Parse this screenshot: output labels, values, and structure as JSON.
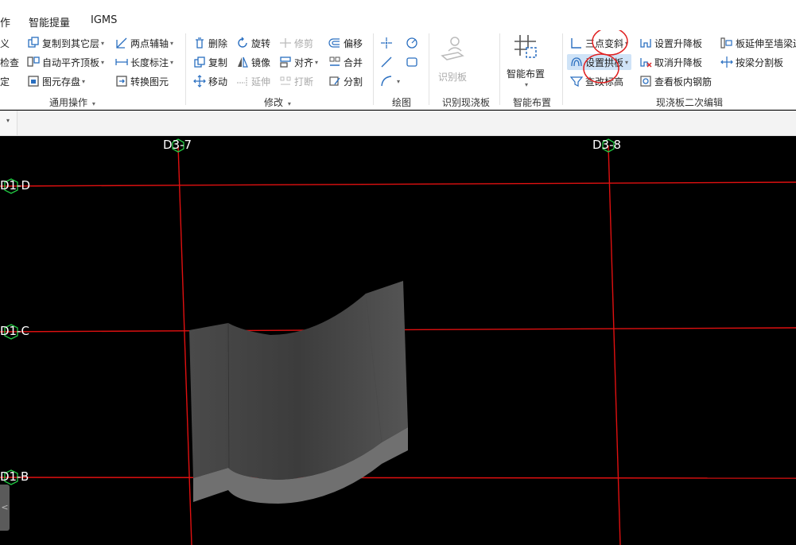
{
  "menubar": {
    "items": [
      {
        "label": "作"
      },
      {
        "label": "智能提量"
      },
      {
        "label": "IGMS"
      }
    ]
  },
  "ribbon": {
    "col0": [
      "义",
      "检查",
      "定"
    ],
    "general": {
      "copy_to_layer": "复制到其它层",
      "auto_align_top": "自动平齐顶板",
      "element_save": "图元存盘",
      "two_point_axis": "两点辅轴",
      "length_mark": "长度标注",
      "convert_element": "转换图元",
      "group_label": "通用操作"
    },
    "modify": {
      "delete": "删除",
      "copy": "复制",
      "move": "移动",
      "rotate": "旋转",
      "mirror": "镜像",
      "extend": "延伸",
      "trim": "修剪",
      "align": "对齐",
      "break": "打断",
      "offset": "偏移",
      "merge": "合并",
      "split": "分割",
      "group_label": "修改"
    },
    "draw": {
      "group_label": "绘图"
    },
    "identify": {
      "identify_board": "识别板",
      "group_label": "识别现浇板"
    },
    "smart": {
      "smart_layout": "智能布置",
      "group_label": "智能布置"
    },
    "edit2": {
      "three_point_slope": "三点变斜",
      "set_arch_board": "设置拱板",
      "check_elevation": "查改标高",
      "set_lift_board": "设置升降板",
      "cancel_lift_board": "取消升降板",
      "view_rebar": "查看板内钢筋",
      "extend_to_wall": "板延伸至墙梁边",
      "split_by_beam": "按梁分割板",
      "group_label": "现浇板二次编辑"
    }
  },
  "canvas": {
    "axes": {
      "col_1": "D3-7",
      "col_2": "D3-8",
      "row_1": "D1-D",
      "row_2": "D1-C",
      "row_3": "D1-B"
    },
    "colors": {
      "grid_line": "#e01010",
      "axis_marker": "#22cc44",
      "slab_face": "#565656",
      "slab_edge": "#7a7a7a"
    },
    "handle_glyph": "<"
  },
  "annotations": {
    "highlight_color": "#e02020"
  }
}
